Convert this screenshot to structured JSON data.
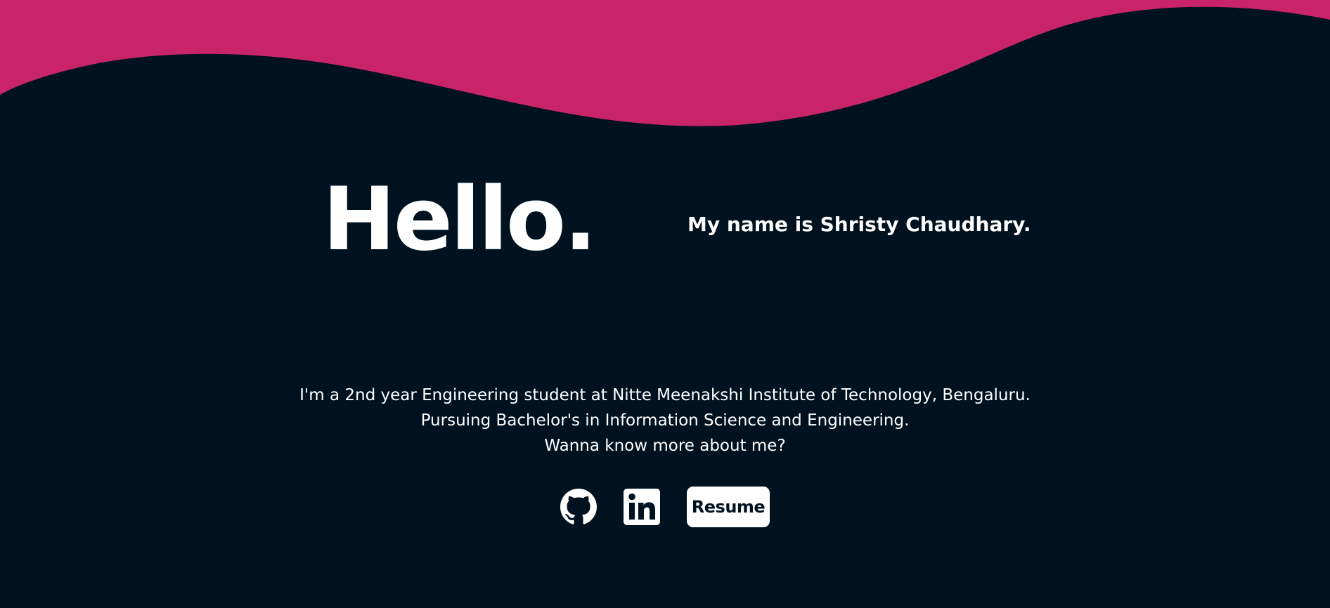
{
  "theme": {
    "background": "#001220",
    "accent": "#C9246A",
    "text": "#FFFFFF",
    "button_background": "#FFFFFF",
    "button_text": "#001220"
  },
  "hero": {
    "greeting": "Hello.",
    "intro": "My name is Shristy Chaudhary."
  },
  "about": {
    "lines": [
      "I'm a 2nd year Engineering student at Nitte Meenakshi Institute of Technology, Bengaluru.",
      "Pursuing Bachelor's in Information Science and Engineering.",
      "Wanna know more about me?"
    ]
  },
  "links": {
    "github_icon": "github-icon",
    "linkedin_icon": "linkedin-icon",
    "resume_label": "Resume"
  }
}
